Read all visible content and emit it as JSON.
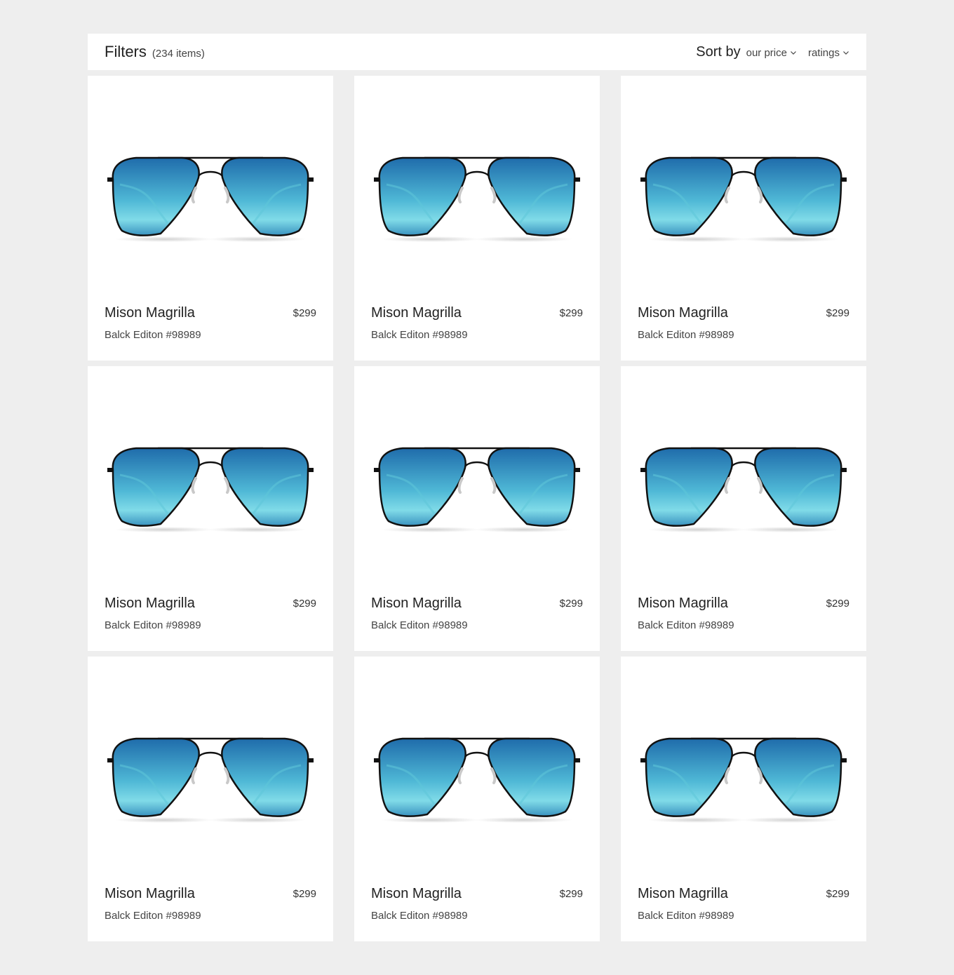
{
  "filters": {
    "label": "Filters",
    "count": "(234 items)"
  },
  "sort": {
    "label": "Sort by",
    "options": [
      {
        "label": "our price",
        "icon": "chevron-down-icon"
      },
      {
        "label": "ratings",
        "icon": "chevron-down-icon"
      }
    ]
  },
  "products": [
    {
      "name": "Mison Magrilla",
      "price": "$299",
      "edition": "Balck Editon #98989",
      "image": "aviator-sunglasses-blue"
    },
    {
      "name": "Mison Magrilla",
      "price": "$299",
      "edition": "Balck Editon #98989",
      "image": "aviator-sunglasses-blue"
    },
    {
      "name": "Mison Magrilla",
      "price": "$299",
      "edition": "Balck Editon #98989",
      "image": "aviator-sunglasses-blue"
    },
    {
      "name": "Mison Magrilla",
      "price": "$299",
      "edition": "Balck Editon #98989",
      "image": "aviator-sunglasses-blue"
    },
    {
      "name": "Mison Magrilla",
      "price": "$299",
      "edition": "Balck Editon #98989",
      "image": "aviator-sunglasses-blue"
    },
    {
      "name": "Mison Magrilla",
      "price": "$299",
      "edition": "Balck Editon #98989",
      "image": "aviator-sunglasses-blue"
    },
    {
      "name": "Mison Magrilla",
      "price": "$299",
      "edition": "Balck Editon #98989",
      "image": "aviator-sunglasses-blue"
    },
    {
      "name": "Mison Magrilla",
      "price": "$299",
      "edition": "Balck Editon #98989",
      "image": "aviator-sunglasses-blue"
    },
    {
      "name": "Mison Magrilla",
      "price": "$299",
      "edition": "Balck Editon #98989",
      "image": "aviator-sunglasses-blue"
    }
  ],
  "colors": {
    "background": "#eeeeee",
    "card": "#ffffff",
    "lens_top": "#1e6fae",
    "lens_bottom": "#7fdbe8",
    "frame": "#111111"
  }
}
